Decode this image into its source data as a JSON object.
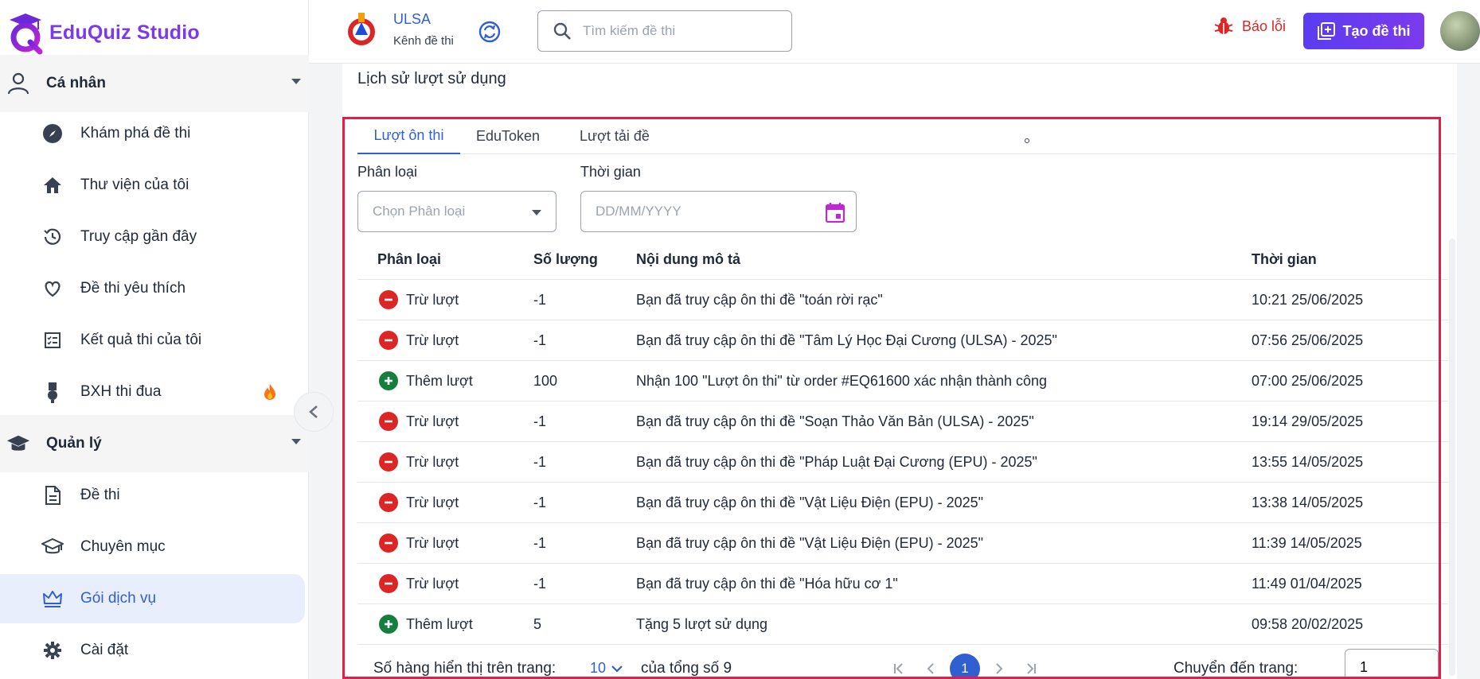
{
  "brand": {
    "name": "EduQuiz Studio",
    "color": "#7c3aed"
  },
  "sidebar": {
    "sections": [
      {
        "label": "Cá nhân",
        "icon": "user-icon"
      },
      {
        "label": "Quản lý",
        "icon": "graduation-cap-icon"
      }
    ],
    "personal_items": [
      {
        "label": "Khám phá đề thi",
        "icon": "compass-icon"
      },
      {
        "label": "Thư viện của tôi",
        "icon": "home-icon"
      },
      {
        "label": "Truy cập gần đây",
        "icon": "history-icon"
      },
      {
        "label": "Đề thi yêu thích",
        "icon": "heart-icon"
      },
      {
        "label": "Kết quả thi của tôi",
        "icon": "result-list-icon"
      },
      {
        "label": "BXH thi đua",
        "icon": "medal-icon"
      }
    ],
    "manage_items": [
      {
        "label": "Đề thi",
        "icon": "document-icon"
      },
      {
        "label": "Chuyên mục",
        "icon": "school-icon"
      },
      {
        "label": "Gói dịch vụ",
        "icon": "crown-icon",
        "active": true
      },
      {
        "label": "Cài đặt",
        "icon": "gear-icon"
      }
    ]
  },
  "header": {
    "channel_name": "ULSA",
    "channel_sub": "Kênh đề thi",
    "search_placeholder": "Tìm kiếm đề thi",
    "report_label": "Báo lỗi",
    "create_label": "Tạo đề thi"
  },
  "main": {
    "title": "Lịch sử lượt sử dụng",
    "tabs": [
      {
        "label": "Lượt ôn thi",
        "active": true
      },
      {
        "label": "EduToken",
        "active": false
      },
      {
        "label": "Lượt tải đề",
        "active": false
      }
    ],
    "filters": {
      "type_label": "Phân loại",
      "type_placeholder": "Chọn Phân loại",
      "time_label": "Thời gian",
      "time_placeholder": "DD/MM/YYYY"
    },
    "table": {
      "columns": [
        "Phân loại",
        "Số lượng",
        "Nội dung mô tả",
        "Thời gian"
      ],
      "rows": [
        {
          "kind": "minus",
          "type": "Trừ lượt",
          "qty": "-1",
          "desc": "Bạn đã truy cập ôn thi đề \"toán rời rạc\"",
          "time": "10:21 25/06/2025"
        },
        {
          "kind": "minus",
          "type": "Trừ lượt",
          "qty": "-1",
          "desc": "Bạn đã truy cập ôn thi đề \"Tâm Lý Học Đại Cương (ULSA) - 2025\"",
          "time": "07:56 25/06/2025"
        },
        {
          "kind": "plus",
          "type": "Thêm lượt",
          "qty": "100",
          "desc": "Nhận 100 \"Lượt ôn thi\" từ order #EQ61600 xác nhận thành công",
          "time": "07:00 25/06/2025"
        },
        {
          "kind": "minus",
          "type": "Trừ lượt",
          "qty": "-1",
          "desc": "Bạn đã truy cập ôn thi đề \"Soạn Thảo Văn Bản (ULSA) - 2025\"",
          "time": "19:14 29/05/2025"
        },
        {
          "kind": "minus",
          "type": "Trừ lượt",
          "qty": "-1",
          "desc": "Bạn đã truy cập ôn thi đề \"Pháp Luật Đại Cương (EPU) - 2025\"",
          "time": "13:55 14/05/2025"
        },
        {
          "kind": "minus",
          "type": "Trừ lượt",
          "qty": "-1",
          "desc": "Bạn đã truy cập ôn thi đề \"Vật Liệu Điện (EPU) - 2025\"",
          "time": "13:38 14/05/2025"
        },
        {
          "kind": "minus",
          "type": "Trừ lượt",
          "qty": "-1",
          "desc": "Bạn đã truy cập ôn thi đề \"Vật Liệu Điện (EPU) - 2025\"",
          "time": "11:39 14/05/2025"
        },
        {
          "kind": "minus",
          "type": "Trừ lượt",
          "qty": "-1",
          "desc": "Bạn đã truy cập ôn thi đề \"Hóa hữu cơ 1\"",
          "time": "11:49 01/04/2025"
        },
        {
          "kind": "plus",
          "type": "Thêm lượt",
          "qty": "5",
          "desc": "Tặng 5 lượt sử dụng",
          "time": "09:58 20/02/2025"
        }
      ]
    },
    "footer": {
      "rows_label": "Số hàng hiển thị trên trang:",
      "rows_value": "10",
      "total_label": "của tổng số 9",
      "current_page": "1",
      "goto_label": "Chuyển đến trang:",
      "goto_value": "1"
    }
  }
}
